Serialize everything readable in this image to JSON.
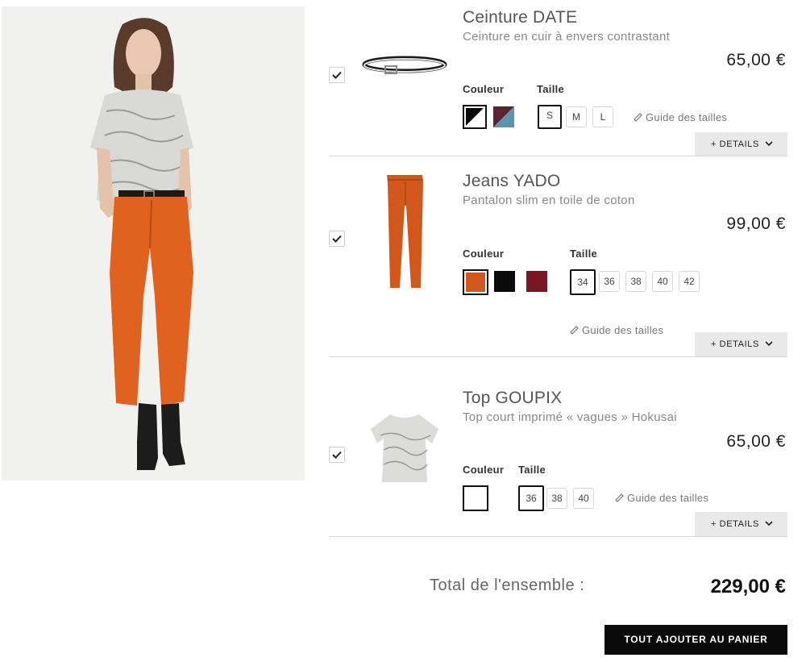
{
  "products": [
    {
      "name": "Ceinture DATE",
      "description": "Ceinture en cuir à envers contrastant",
      "price": "65,00 €",
      "checked": true,
      "color_label": "Couleur",
      "size_label": "Taille",
      "sizes": [
        "S",
        "M",
        "L"
      ],
      "selected_size": "S",
      "size_guide": "Guide des tailles",
      "details": "+ DETAILS"
    },
    {
      "name": "Jeans YADO",
      "description": "Pantalon slim en toile de coton",
      "price": "99,00 €",
      "checked": true,
      "color_label": "Couleur",
      "size_label": "Taille",
      "sizes": [
        "34",
        "36",
        "38",
        "40",
        "42"
      ],
      "selected_size": "34",
      "size_guide": "Guide des tailles",
      "details": "+ DETAILS"
    },
    {
      "name": "Top GOUPIX",
      "description": "Top court imprimé « vagues » Hokusai",
      "price": "65,00 €",
      "checked": true,
      "color_label": "Couleur",
      "size_label": "Taille",
      "sizes": [
        "36",
        "38",
        "40"
      ],
      "selected_size": "36",
      "size_guide": "Guide des tailles",
      "details": "+ DETAILS"
    }
  ],
  "total": {
    "label": "Total de l'ensemble :",
    "value": "229,00 €"
  },
  "cart_button": "TOUT AJOUTER AU PANIER",
  "colors": {
    "orange": "#d2571b",
    "black": "#0a0a0a",
    "burgundy": "#7a1622",
    "wine": "#5a2430",
    "blue": "#5b96ad",
    "white": "#ffffff"
  }
}
